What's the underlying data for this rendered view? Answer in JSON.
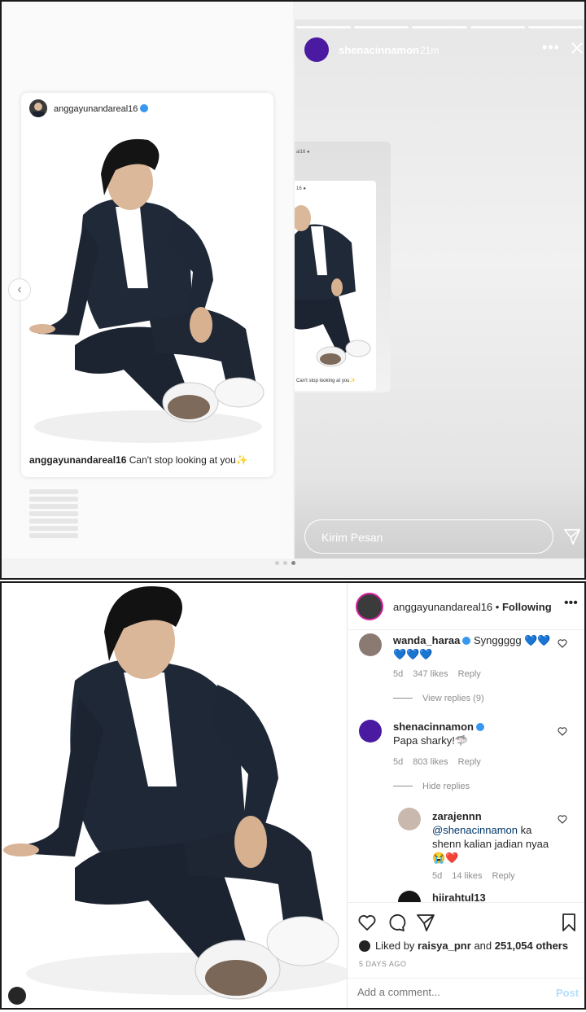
{
  "story": {
    "username": "shenacinnamon",
    "time": "21m",
    "more": "•••",
    "message_placeholder": "Kirim Pesan",
    "shared_post": {
      "username": "anggayunandareal16",
      "caption_user": "anggayunandareal16",
      "caption_text": "Can't stop looking at you✨"
    },
    "mini_post": {
      "top_label": "al16 ●",
      "user_label": "16 ●",
      "caption": "Can't stop looking at you✨"
    }
  },
  "post": {
    "username": "anggayunandareal16",
    "separator": "•",
    "follow_label": "Following",
    "more": "•••",
    "comments": [
      {
        "user": "wanda_haraa",
        "text": "Synggggg 💙💙💙💙💙",
        "age": "5d",
        "likes": "347 likes",
        "reply": "Reply",
        "avatar_color": "#8a7a72"
      },
      {
        "user": "shenacinnamon",
        "text": "Papa sharky!🦈",
        "age": "5d",
        "likes": "803 likes",
        "reply": "Reply",
        "avatar_color": "#4a1aa0"
      }
    ],
    "view_replies": "View replies (9)",
    "hide_replies": "Hide replies",
    "reply": {
      "user": "zarajennn",
      "mention": "@shenacinnamon",
      "text": "ka shenn kalian jadian nyaa😭❤️",
      "age": "5d",
      "likes": "14 likes",
      "reply": "Reply",
      "avatar_color": "#c8b8ae"
    },
    "partial_user": "hiirahtul13",
    "liked_by_prefix": "Liked by",
    "liked_by_user": "raisya_pnr",
    "liked_by_and": "and",
    "liked_by_count": "251,054 others",
    "posted_ago": "5 DAYS AGO",
    "comment_placeholder": "Add a comment...",
    "post_label": "Post"
  }
}
